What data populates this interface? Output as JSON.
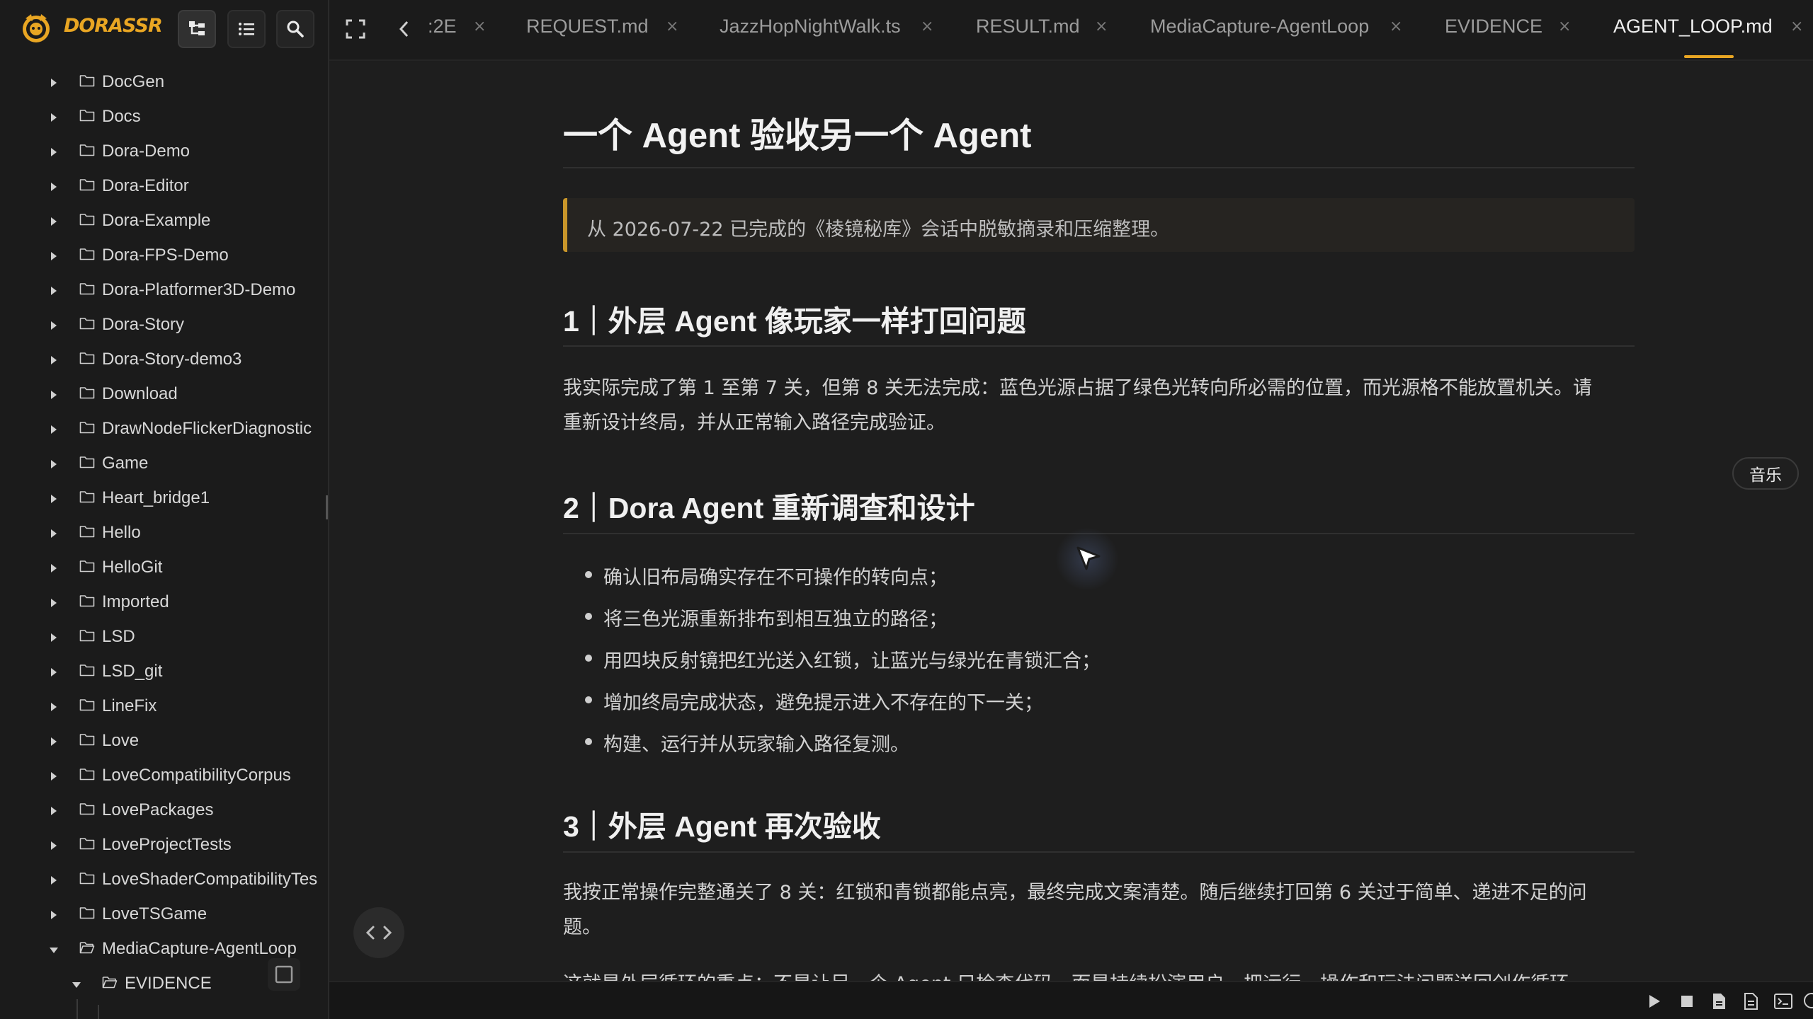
{
  "app": {
    "logo_text": "DORASSR",
    "accent_color": "#e9a623"
  },
  "sidebar": {
    "header_buttons": [
      {
        "icon": "tree-view-icon",
        "active": true
      },
      {
        "icon": "list-icon",
        "active": false
      },
      {
        "icon": "search-icon",
        "active": false
      }
    ],
    "items": [
      {
        "label": "DocGen",
        "expanded": false
      },
      {
        "label": "Docs",
        "expanded": false
      },
      {
        "label": "Dora-Demo",
        "expanded": false
      },
      {
        "label": "Dora-Editor",
        "expanded": false
      },
      {
        "label": "Dora-Example",
        "expanded": false
      },
      {
        "label": "Dora-FPS-Demo",
        "expanded": false
      },
      {
        "label": "Dora-Platformer3D-Demo",
        "expanded": false
      },
      {
        "label": "Dora-Story",
        "expanded": false
      },
      {
        "label": "Dora-Story-demo3",
        "expanded": false
      },
      {
        "label": "Download",
        "expanded": false
      },
      {
        "label": "DrawNodeFlickerDiagnostic",
        "expanded": false
      },
      {
        "label": "Game",
        "expanded": false
      },
      {
        "label": "Heart_bridge1",
        "expanded": false
      },
      {
        "label": "Hello",
        "expanded": false
      },
      {
        "label": "HelloGit",
        "expanded": false
      },
      {
        "label": "Imported",
        "expanded": false
      },
      {
        "label": "LSD",
        "expanded": false
      },
      {
        "label": "LSD_git",
        "expanded": false
      },
      {
        "label": "LineFix",
        "expanded": false
      },
      {
        "label": "Love",
        "expanded": false
      },
      {
        "label": "LoveCompatibilityCorpus",
        "expanded": false
      },
      {
        "label": "LovePackages",
        "expanded": false
      },
      {
        "label": "LoveProjectTests",
        "expanded": false
      },
      {
        "label": "LoveShaderCompatibilityTes",
        "expanded": false
      },
      {
        "label": "LoveTSGame",
        "expanded": false
      },
      {
        "label": "MediaCapture-AgentLoop",
        "expanded": true
      },
      {
        "label": "EVIDENCE",
        "expanded": true,
        "child": true
      }
    ]
  },
  "tabs": {
    "items": [
      {
        "label": ":2E",
        "active": false
      },
      {
        "label": "REQUEST.md",
        "active": false
      },
      {
        "label": "JazzHopNightWalk.ts",
        "active": false
      },
      {
        "label": "RESULT.md",
        "active": false
      },
      {
        "label": "MediaCapture-AgentLoop",
        "active": false
      },
      {
        "label": "EVIDENCE",
        "active": false
      },
      {
        "label": "AGENT_LOOP.md",
        "active": true
      }
    ],
    "close_glyph": "×"
  },
  "document": {
    "title": "一个 Agent 验收另一个 Agent",
    "quote": "从 2026-07-22 已完成的《棱镜秘库》会话中脱敏摘录和压缩整理。",
    "sections": [
      {
        "heading": "1｜外层 Agent 像玩家一样打回问题",
        "paragraph_lines": [
          "我实际完成了第 1 至第 7 关，但第 8 关无法完成：蓝色光源占据了绿色光转向所必需的位置，而光源格不能放置机关。请",
          "重新设计终局，并从正常输入路径完成验证。"
        ]
      },
      {
        "heading": "2｜Dora Agent 重新调查和设计",
        "bullets": [
          "确认旧布局确实存在不可操作的转向点；",
          "将三色光源重新排布到相互独立的路径；",
          "用四块反射镜把红光送入红锁，让蓝光与绿光在青锁汇合；",
          "增加终局完成状态，避免提示进入不存在的下一关；",
          "构建、运行并从玩家输入路径复测。"
        ]
      },
      {
        "heading": "3｜外层 Agent 再次验收",
        "paragraph_lines": [
          "我按正常操作完整通关了 8 关：红锁和青锁都能点亮，最终完成文案清楚。随后继续打回第 6 关过于简单、递进不足的问",
          "题。"
        ],
        "cut_line": "这就是外层循环的重点：不是让另一个 Agent 只检查代码，而是持续扮演用户，把运行、操作和玩法问题送回创作循环"
      }
    ]
  },
  "floating": {
    "music_label": "音乐"
  },
  "bottombar": {
    "icons": [
      "play-icon",
      "stop-icon",
      "file-icon",
      "document-icon",
      "terminal-icon",
      "chat-icon"
    ]
  }
}
